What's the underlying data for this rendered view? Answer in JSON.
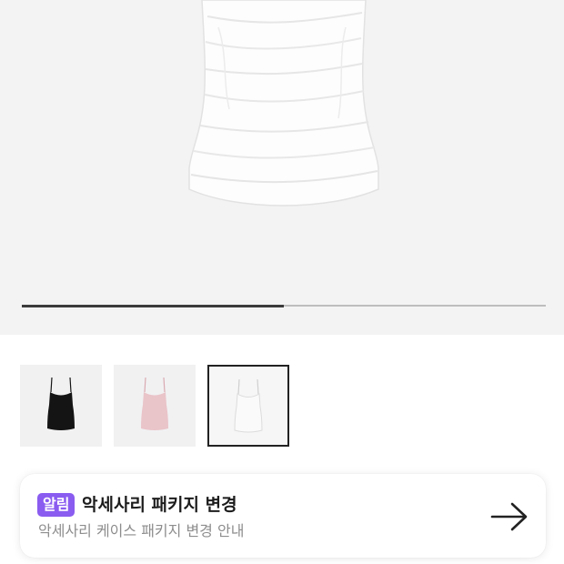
{
  "product": {
    "image_progress": 0.5,
    "thumbnails": [
      {
        "name": "black",
        "color": "#141414",
        "selected": false
      },
      {
        "name": "pink",
        "color": "#e9c4c9",
        "selected": false
      },
      {
        "name": "white",
        "color": "#fafafa",
        "selected": true
      }
    ]
  },
  "notice": {
    "badge": "알림",
    "title": "악세사리 패키지 변경",
    "subtitle": "악세사리 케이스 패키지 변경 안내",
    "arrow_icon": "arrow-right-icon"
  },
  "colors": {
    "hero_bg": "#f3f3f4",
    "badge_bg": "#8a5cf0",
    "progress_fill": "#3b3b3b"
  }
}
